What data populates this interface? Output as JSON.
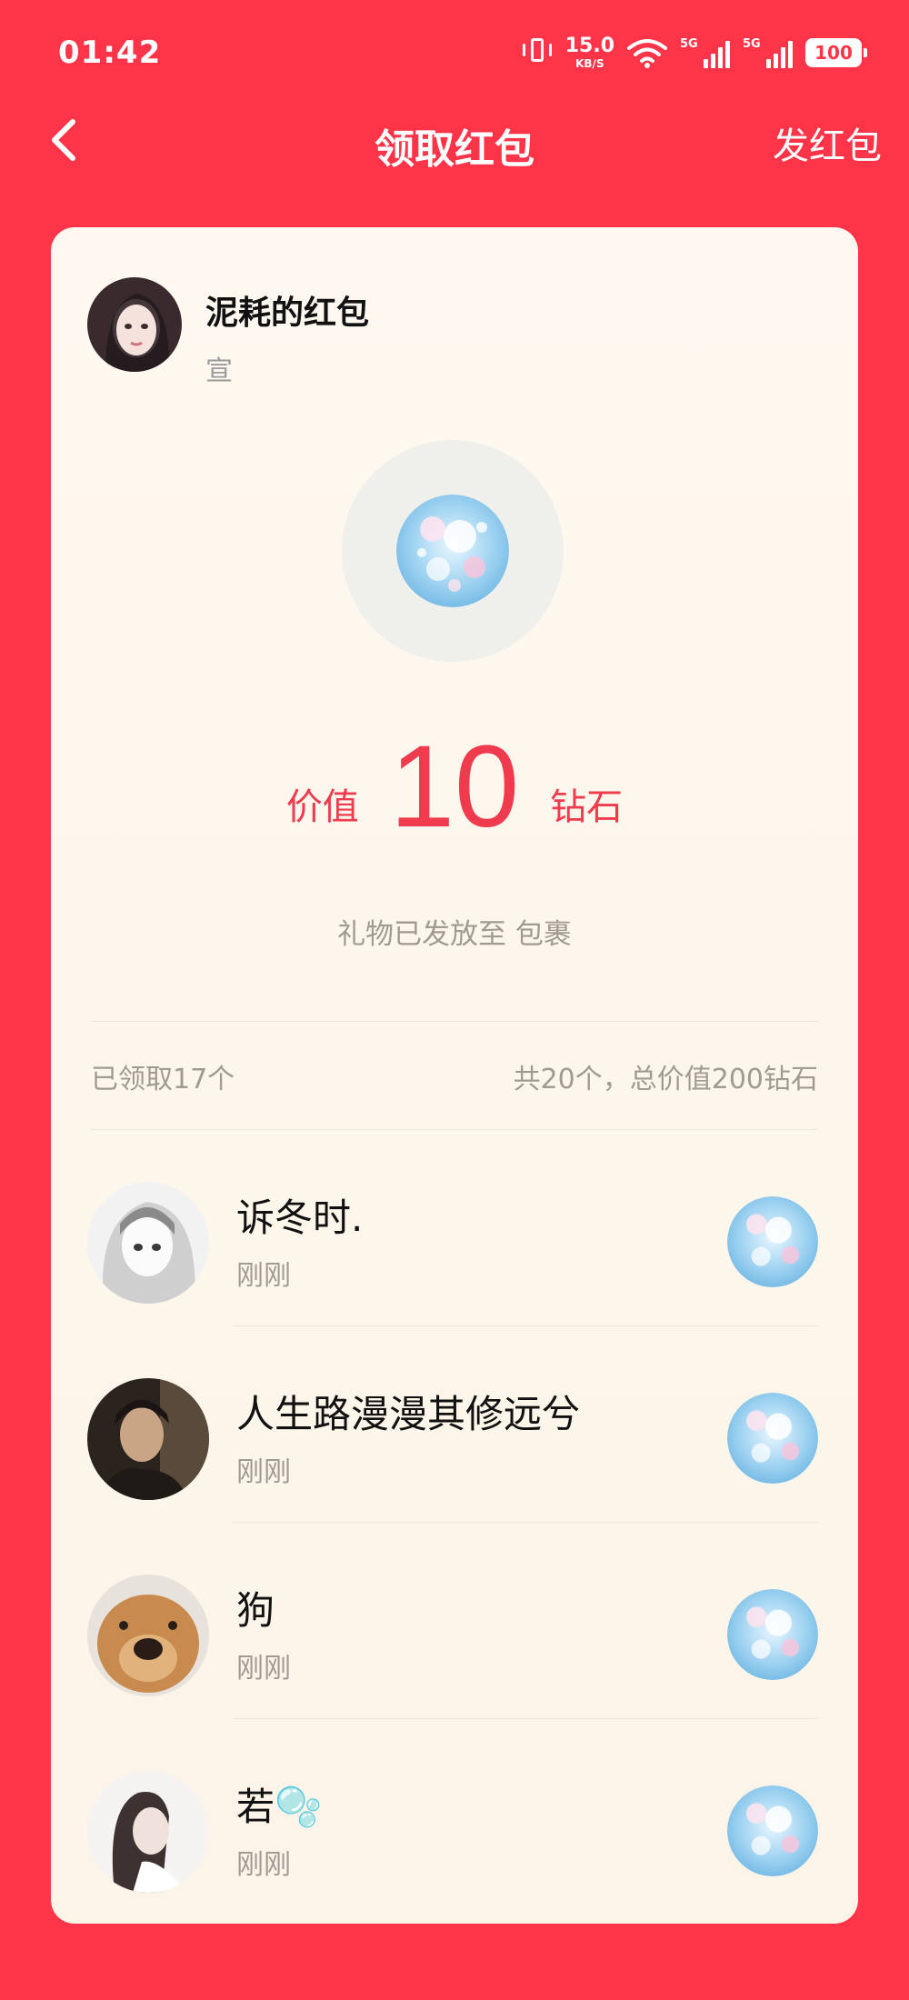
{
  "status_bar": {
    "time": "01:42",
    "net_speed": "15.0",
    "net_unit": "KB/S",
    "sim1": "5G",
    "sim2": "5G",
    "battery": "100"
  },
  "nav": {
    "title": "领取红包",
    "action": "发红包"
  },
  "sender": {
    "name": "泥耗的红包",
    "subtitle": "宣"
  },
  "value": {
    "prefix": "价值",
    "amount": "10",
    "unit": "钻石"
  },
  "delivery_note": "礼物已发放至 包裹",
  "summary": {
    "claimed": "已领取17个",
    "total": "共20个，总价值200钻石"
  },
  "recipients": [
    {
      "name": "诉冬时.",
      "time": "刚刚"
    },
    {
      "name": "人生路漫漫其修远兮",
      "time": "刚刚"
    },
    {
      "name": "狗",
      "time": "刚刚"
    },
    {
      "name": "若🫧",
      "time": "刚刚"
    }
  ],
  "colors": {
    "brand_red": "#FF3448",
    "value_red": "#F03A4E",
    "card_bg": "#FEF8F0"
  }
}
